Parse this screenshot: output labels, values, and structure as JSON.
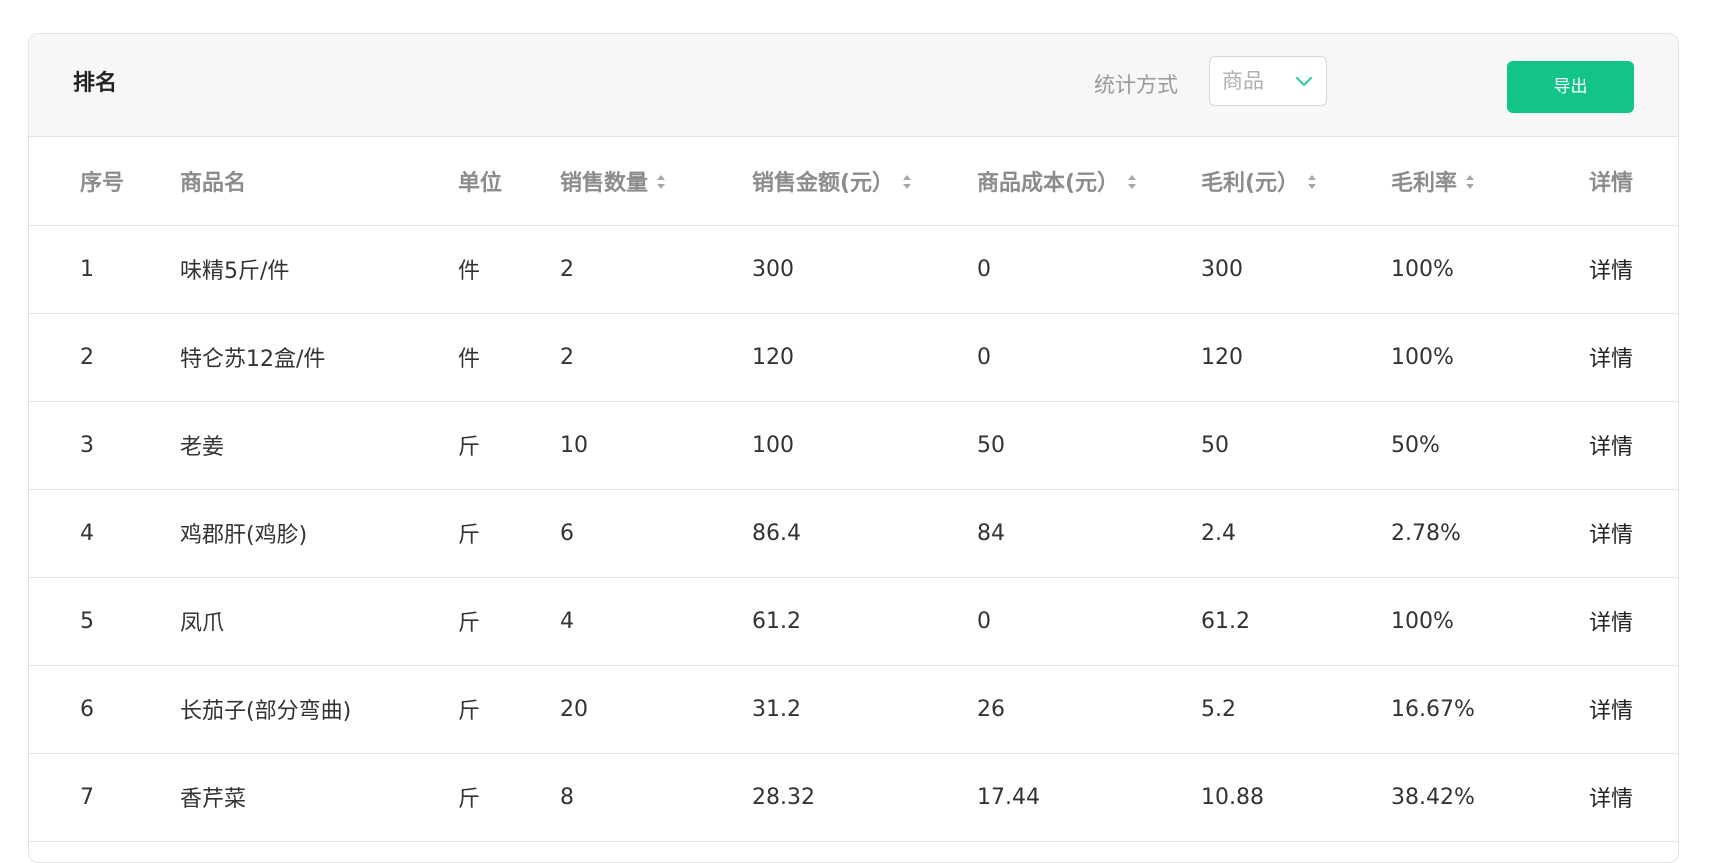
{
  "panel": {
    "title": "排名",
    "stat_label": "统计方式",
    "stat_select": {
      "value": "商品"
    },
    "export_label": "导出"
  },
  "colors": {
    "accent": "#12c38a",
    "header_bg": "#f7f7f7",
    "border": "#e4e4e4"
  },
  "table": {
    "columns": [
      {
        "label": "序号",
        "sortable": false
      },
      {
        "label": "商品名",
        "sortable": false
      },
      {
        "label": "单位",
        "sortable": false
      },
      {
        "label": "销售数量",
        "sortable": true
      },
      {
        "label": "销售金额(元）",
        "sortable": true
      },
      {
        "label": "商品成本(元）",
        "sortable": true
      },
      {
        "label": "毛利(元）",
        "sortable": true
      },
      {
        "label": "毛利率",
        "sortable": true
      },
      {
        "label": "详情",
        "sortable": false
      }
    ],
    "rows": [
      [
        "1",
        "味精5斤/件",
        "件",
        "2",
        "300",
        "0",
        "300",
        "100%",
        "详情"
      ],
      [
        "2",
        "特仑苏12盒/件",
        "件",
        "2",
        "120",
        "0",
        "120",
        "100%",
        "详情"
      ],
      [
        "3",
        "老姜",
        "斤",
        "10",
        "100",
        "50",
        "50",
        "50%",
        "详情"
      ],
      [
        "4",
        "鸡郡肝(鸡胗)",
        "斤",
        "6",
        "86.4",
        "84",
        "2.4",
        "2.78%",
        "详情"
      ],
      [
        "5",
        "凤爪",
        "斤",
        "4",
        "61.2",
        "0",
        "61.2",
        "100%",
        "详情"
      ],
      [
        "6",
        "长茄子(部分弯曲)",
        "斤",
        "20",
        "31.2",
        "26",
        "5.2",
        "16.67%",
        "详情"
      ],
      [
        "7",
        "香芹菜",
        "斤",
        "8",
        "28.32",
        "17.44",
        "10.88",
        "38.42%",
        "详情"
      ]
    ]
  }
}
